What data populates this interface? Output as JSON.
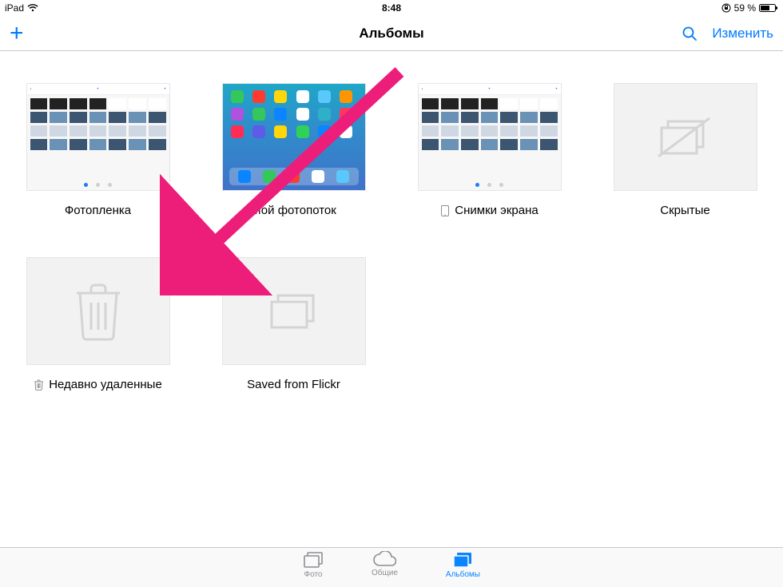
{
  "status": {
    "device": "iPad",
    "time": "8:48",
    "battery_text": "59 %"
  },
  "nav": {
    "title": "Альбомы",
    "add": "+",
    "edit": "Изменить"
  },
  "albums": [
    {
      "id": "camera-roll",
      "label": "Фотопленка"
    },
    {
      "id": "photostream",
      "label": "Мой фотопоток"
    },
    {
      "id": "screenshots",
      "label": "Снимки экрана"
    },
    {
      "id": "hidden",
      "label": "Скрытые"
    },
    {
      "id": "recently-deleted",
      "label": "Недавно удаленные"
    },
    {
      "id": "saved-flickr",
      "label": "Saved from Flickr"
    }
  ],
  "tabs": {
    "photos": "Фото",
    "shared": "Общие",
    "albums": "Альбомы"
  },
  "colors": {
    "ios_blue": "#007aff",
    "tab_inactive": "#8e8e93",
    "annotation": "#ed1e79"
  }
}
